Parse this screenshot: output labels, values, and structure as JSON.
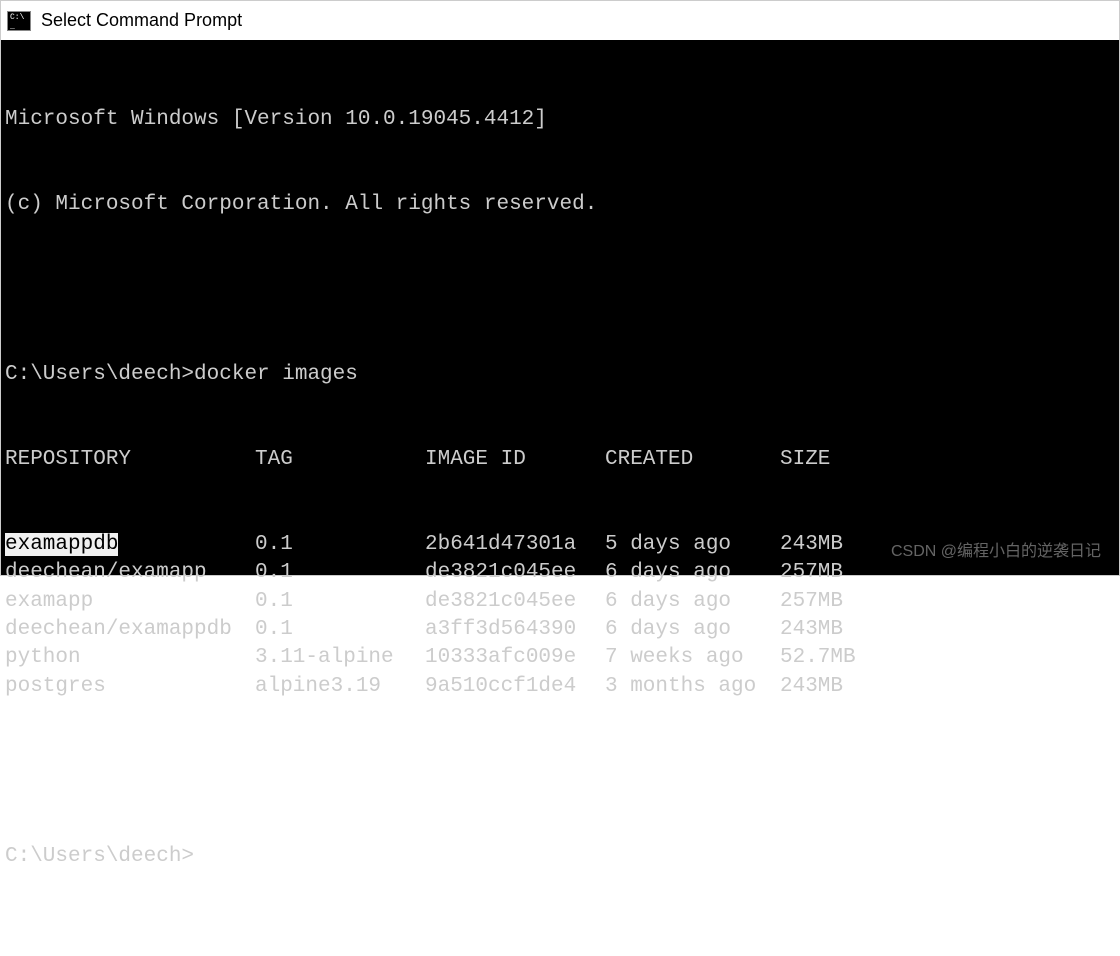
{
  "titlebar": {
    "text": "Select Command Prompt"
  },
  "terminal": {
    "banner1": "Microsoft Windows [Version 10.0.19045.4412]",
    "banner2": "(c) Microsoft Corporation. All rights reserved.",
    "prompt1_path": "C:\\Users\\deech>",
    "prompt1_cmd": "docker images",
    "headers": {
      "repository": "REPOSITORY",
      "tag": "TAG",
      "image_id": "IMAGE ID",
      "created": "CREATED",
      "size": "SIZE"
    },
    "rows": [
      {
        "repository": "examappdb",
        "tag": "0.1",
        "image_id": "2b641d47301a",
        "created": "5 days ago",
        "size": "243MB",
        "highlight": true
      },
      {
        "repository": "deechean/examapp",
        "tag": "0.1",
        "image_id": "de3821c045ee",
        "created": "6 days ago",
        "size": "257MB",
        "highlight": false
      },
      {
        "repository": "examapp",
        "tag": "0.1",
        "image_id": "de3821c045ee",
        "created": "6 days ago",
        "size": "257MB",
        "highlight": false
      },
      {
        "repository": "deechean/examappdb",
        "tag": "0.1",
        "image_id": "a3ff3d564390",
        "created": "6 days ago",
        "size": "243MB",
        "highlight": false
      },
      {
        "repository": "python",
        "tag": "3.11-alpine",
        "image_id": "10333afc009e",
        "created": "7 weeks ago",
        "size": "52.7MB",
        "highlight": false
      },
      {
        "repository": "postgres",
        "tag": "alpine3.19",
        "image_id": "9a510ccf1de4",
        "created": "3 months ago",
        "size": "243MB",
        "highlight": false
      }
    ],
    "prompt2_path": "C:\\Users\\deech>"
  },
  "watermark": "CSDN @编程小白的逆袭日记"
}
